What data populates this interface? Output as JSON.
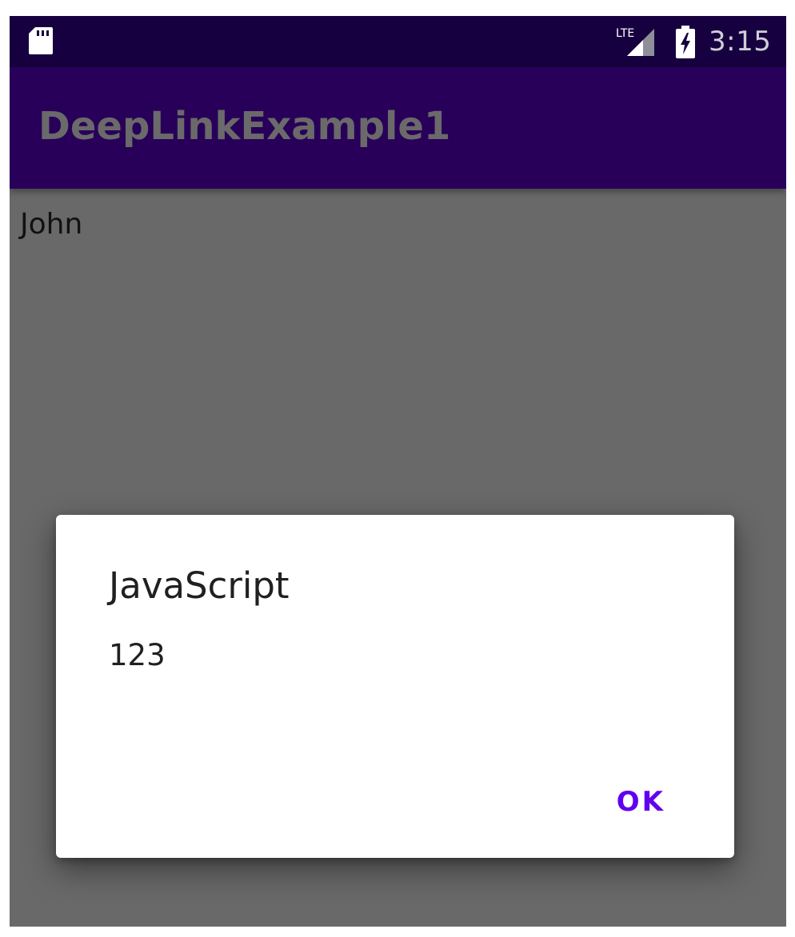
{
  "status_bar": {
    "network_label": "LTE",
    "time": "3:15",
    "icons": {
      "sd": "sd-card-icon",
      "signal": "lte-signal-icon",
      "battery": "battery-charging-icon"
    }
  },
  "app_bar": {
    "title": "DeepLinkExample1"
  },
  "content": {
    "name_text": "John"
  },
  "dialog": {
    "title": "JavaScript",
    "message": "123",
    "ok_label": "OK"
  },
  "colors": {
    "status_bar_bg": "#17003f",
    "app_bar_bg": "#290059",
    "scrim": "#696969",
    "dialog_bg": "#ffffff",
    "accent": "#6200ee"
  }
}
